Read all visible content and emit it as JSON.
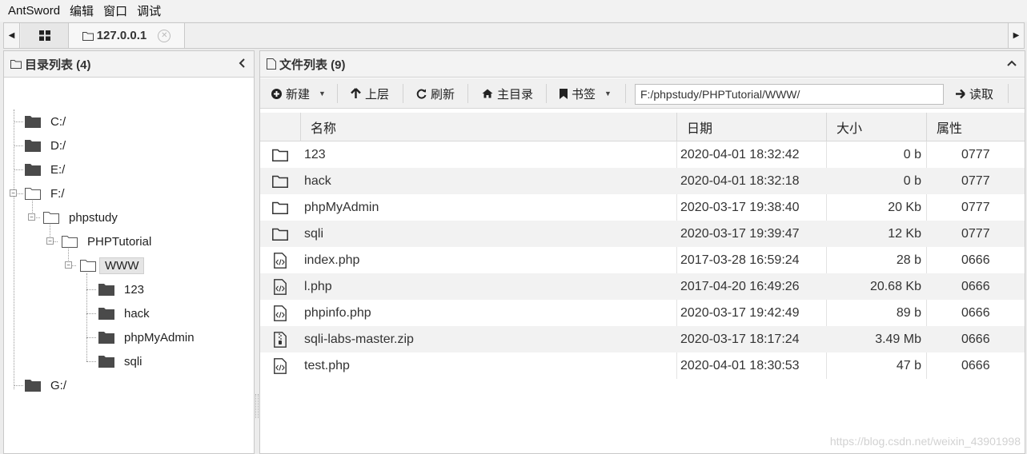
{
  "menubar": {
    "items": [
      "AntSword",
      "编辑",
      "窗口",
      "调试"
    ]
  },
  "tabs": {
    "home_icon": "grid-icon",
    "shell_tab_label": "127.0.0.1"
  },
  "left_panel": {
    "title": "目录列表 (4)",
    "tree": [
      {
        "label": "C:/"
      },
      {
        "label": "D:/"
      },
      {
        "label": "E:/"
      },
      {
        "label": "F:/"
      },
      {
        "label": "phpstudy"
      },
      {
        "label": "PHPTutorial"
      },
      {
        "label": "WWW",
        "selected": true
      },
      {
        "label": "123"
      },
      {
        "label": "hack"
      },
      {
        "label": "phpMyAdmin"
      },
      {
        "label": "sqli"
      },
      {
        "label": "G:/"
      }
    ]
  },
  "right_panel": {
    "title": "文件列表 (9)",
    "toolbar": {
      "new_label": "新建",
      "up_label": "上层",
      "refresh_label": "刷新",
      "home_label": "主目录",
      "bookmark_label": "书签",
      "path_value": "F:/phpstudy/PHPTutorial/WWW/",
      "read_label": "读取"
    },
    "columns": {
      "name": "名称",
      "date": "日期",
      "size": "大小",
      "attr": "属性"
    },
    "files": [
      {
        "icon": "folder-icon",
        "name": "123",
        "date": "2020-04-01 18:32:42",
        "size": "0 b",
        "attr": "0777"
      },
      {
        "icon": "folder-icon",
        "name": "hack",
        "date": "2020-04-01 18:32:18",
        "size": "0 b",
        "attr": "0777"
      },
      {
        "icon": "folder-icon",
        "name": "phpMyAdmin",
        "date": "2020-03-17 19:38:40",
        "size": "20 Kb",
        "attr": "0777"
      },
      {
        "icon": "folder-icon",
        "name": "sqli",
        "date": "2020-03-17 19:39:47",
        "size": "12 Kb",
        "attr": "0777"
      },
      {
        "icon": "code-file-icon",
        "name": "index.php",
        "date": "2017-03-28 16:59:24",
        "size": "28 b",
        "attr": "0666"
      },
      {
        "icon": "code-file-icon",
        "name": "l.php",
        "date": "2017-04-20 16:49:26",
        "size": "20.68 Kb",
        "attr": "0666"
      },
      {
        "icon": "code-file-icon",
        "name": "phpinfo.php",
        "date": "2020-03-17 19:42:49",
        "size": "89 b",
        "attr": "0666"
      },
      {
        "icon": "archive-file-icon",
        "name": "sqli-labs-master.zip",
        "date": "2020-03-17 18:17:24",
        "size": "3.49 Mb",
        "attr": "0666"
      },
      {
        "icon": "code-file-icon",
        "name": "test.php",
        "date": "2020-04-01 18:30:53",
        "size": "47 b",
        "attr": "0666"
      }
    ]
  },
  "watermark": "https://blog.csdn.net/weixin_43901998"
}
